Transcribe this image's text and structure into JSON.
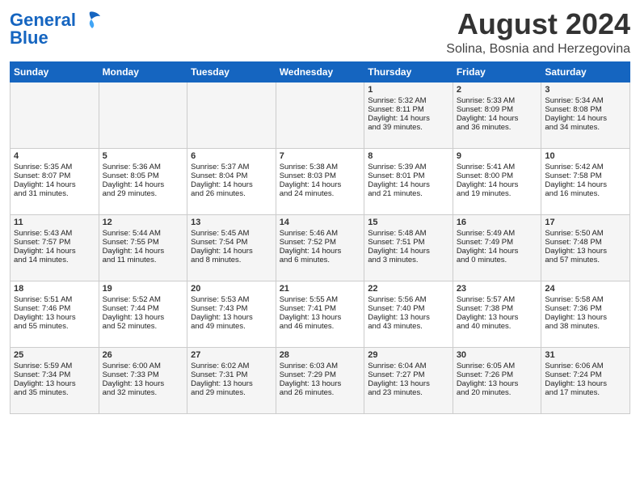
{
  "logo": {
    "line1": "General",
    "line2": "Blue"
  },
  "title": "August 2024",
  "location": "Solina, Bosnia and Herzegovina",
  "weekdays": [
    "Sunday",
    "Monday",
    "Tuesday",
    "Wednesday",
    "Thursday",
    "Friday",
    "Saturday"
  ],
  "weeks": [
    [
      {
        "day": "",
        "content": ""
      },
      {
        "day": "",
        "content": ""
      },
      {
        "day": "",
        "content": ""
      },
      {
        "day": "",
        "content": ""
      },
      {
        "day": "1",
        "content": "Sunrise: 5:32 AM\nSunset: 8:11 PM\nDaylight: 14 hours\nand 39 minutes."
      },
      {
        "day": "2",
        "content": "Sunrise: 5:33 AM\nSunset: 8:09 PM\nDaylight: 14 hours\nand 36 minutes."
      },
      {
        "day": "3",
        "content": "Sunrise: 5:34 AM\nSunset: 8:08 PM\nDaylight: 14 hours\nand 34 minutes."
      }
    ],
    [
      {
        "day": "4",
        "content": "Sunrise: 5:35 AM\nSunset: 8:07 PM\nDaylight: 14 hours\nand 31 minutes."
      },
      {
        "day": "5",
        "content": "Sunrise: 5:36 AM\nSunset: 8:05 PM\nDaylight: 14 hours\nand 29 minutes."
      },
      {
        "day": "6",
        "content": "Sunrise: 5:37 AM\nSunset: 8:04 PM\nDaylight: 14 hours\nand 26 minutes."
      },
      {
        "day": "7",
        "content": "Sunrise: 5:38 AM\nSunset: 8:03 PM\nDaylight: 14 hours\nand 24 minutes."
      },
      {
        "day": "8",
        "content": "Sunrise: 5:39 AM\nSunset: 8:01 PM\nDaylight: 14 hours\nand 21 minutes."
      },
      {
        "day": "9",
        "content": "Sunrise: 5:41 AM\nSunset: 8:00 PM\nDaylight: 14 hours\nand 19 minutes."
      },
      {
        "day": "10",
        "content": "Sunrise: 5:42 AM\nSunset: 7:58 PM\nDaylight: 14 hours\nand 16 minutes."
      }
    ],
    [
      {
        "day": "11",
        "content": "Sunrise: 5:43 AM\nSunset: 7:57 PM\nDaylight: 14 hours\nand 14 minutes."
      },
      {
        "day": "12",
        "content": "Sunrise: 5:44 AM\nSunset: 7:55 PM\nDaylight: 14 hours\nand 11 minutes."
      },
      {
        "day": "13",
        "content": "Sunrise: 5:45 AM\nSunset: 7:54 PM\nDaylight: 14 hours\nand 8 minutes."
      },
      {
        "day": "14",
        "content": "Sunrise: 5:46 AM\nSunset: 7:52 PM\nDaylight: 14 hours\nand 6 minutes."
      },
      {
        "day": "15",
        "content": "Sunrise: 5:48 AM\nSunset: 7:51 PM\nDaylight: 14 hours\nand 3 minutes."
      },
      {
        "day": "16",
        "content": "Sunrise: 5:49 AM\nSunset: 7:49 PM\nDaylight: 14 hours\nand 0 minutes."
      },
      {
        "day": "17",
        "content": "Sunrise: 5:50 AM\nSunset: 7:48 PM\nDaylight: 13 hours\nand 57 minutes."
      }
    ],
    [
      {
        "day": "18",
        "content": "Sunrise: 5:51 AM\nSunset: 7:46 PM\nDaylight: 13 hours\nand 55 minutes."
      },
      {
        "day": "19",
        "content": "Sunrise: 5:52 AM\nSunset: 7:44 PM\nDaylight: 13 hours\nand 52 minutes."
      },
      {
        "day": "20",
        "content": "Sunrise: 5:53 AM\nSunset: 7:43 PM\nDaylight: 13 hours\nand 49 minutes."
      },
      {
        "day": "21",
        "content": "Sunrise: 5:55 AM\nSunset: 7:41 PM\nDaylight: 13 hours\nand 46 minutes."
      },
      {
        "day": "22",
        "content": "Sunrise: 5:56 AM\nSunset: 7:40 PM\nDaylight: 13 hours\nand 43 minutes."
      },
      {
        "day": "23",
        "content": "Sunrise: 5:57 AM\nSunset: 7:38 PM\nDaylight: 13 hours\nand 40 minutes."
      },
      {
        "day": "24",
        "content": "Sunrise: 5:58 AM\nSunset: 7:36 PM\nDaylight: 13 hours\nand 38 minutes."
      }
    ],
    [
      {
        "day": "25",
        "content": "Sunrise: 5:59 AM\nSunset: 7:34 PM\nDaylight: 13 hours\nand 35 minutes."
      },
      {
        "day": "26",
        "content": "Sunrise: 6:00 AM\nSunset: 7:33 PM\nDaylight: 13 hours\nand 32 minutes."
      },
      {
        "day": "27",
        "content": "Sunrise: 6:02 AM\nSunset: 7:31 PM\nDaylight: 13 hours\nand 29 minutes."
      },
      {
        "day": "28",
        "content": "Sunrise: 6:03 AM\nSunset: 7:29 PM\nDaylight: 13 hours\nand 26 minutes."
      },
      {
        "day": "29",
        "content": "Sunrise: 6:04 AM\nSunset: 7:27 PM\nDaylight: 13 hours\nand 23 minutes."
      },
      {
        "day": "30",
        "content": "Sunrise: 6:05 AM\nSunset: 7:26 PM\nDaylight: 13 hours\nand 20 minutes."
      },
      {
        "day": "31",
        "content": "Sunrise: 6:06 AM\nSunset: 7:24 PM\nDaylight: 13 hours\nand 17 minutes."
      }
    ]
  ]
}
